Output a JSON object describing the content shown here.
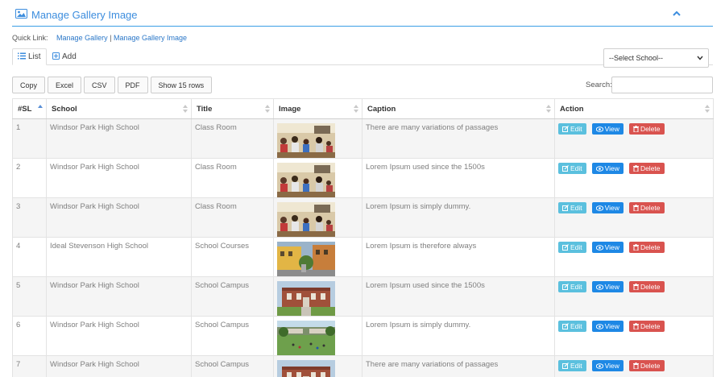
{
  "header": {
    "title": "Manage Gallery Image"
  },
  "quick_links": {
    "label": "Quick Link:",
    "items": [
      "Manage Gallery",
      "Manage Gallery Image"
    ],
    "separator": "|"
  },
  "tabs": [
    {
      "label": "List",
      "active": true
    },
    {
      "label": "Add",
      "active": false
    }
  ],
  "school_select": {
    "selected": "--Select School--"
  },
  "export_buttons": [
    "Copy",
    "Excel",
    "CSV",
    "PDF",
    "Show 15 rows"
  ],
  "search": {
    "label": "Search:",
    "value": "",
    "placeholder": ""
  },
  "table": {
    "columns": [
      "#SL",
      "School",
      "Title",
      "Image",
      "Caption",
      "Action"
    ],
    "sorted_column": "#SL",
    "rows": [
      {
        "sl": "1",
        "school": "Windsor Park High School",
        "title": "Class Room",
        "caption": "There are many variations of passages",
        "image": "classroom"
      },
      {
        "sl": "2",
        "school": "Windsor Park High School",
        "title": "Class Room",
        "caption": "Lorem Ipsum used since the 1500s",
        "image": "classroom"
      },
      {
        "sl": "3",
        "school": "Windsor Park High School",
        "title": "Class Room",
        "caption": "Lorem Ipsum is simply dummy.",
        "image": "classroom"
      },
      {
        "sl": "4",
        "school": "Ideal Stevenson High School",
        "title": "School Courses",
        "caption": "Lorem Ipsum is therefore always",
        "image": "courtyard"
      },
      {
        "sl": "5",
        "school": "Windsor Park High School",
        "title": "School Campus",
        "caption": "Lorem Ipsum used since the 1500s",
        "image": "campus-building"
      },
      {
        "sl": "6",
        "school": "Windsor Park High School",
        "title": "School Campus",
        "caption": "Lorem Ipsum is simply dummy.",
        "image": "campus-lawn"
      },
      {
        "sl": "7",
        "school": "Windsor Park High School",
        "title": "School Campus",
        "caption": "There are many variations of passages",
        "image": "campus-building"
      }
    ],
    "actions": {
      "edit": "Edit",
      "view": "View",
      "delete": "Delete"
    }
  },
  "colors": {
    "accent": "#3c8dde",
    "edit": "#5bc0de",
    "view": "#1e88e5",
    "delete": "#d9534f",
    "row_stripe": "#f5f5f5"
  },
  "icons": {
    "header": "image-icon",
    "collapse": "chevron-up-icon",
    "list_tab": "list-icon",
    "add_tab": "plus-square-icon",
    "edit": "edit-icon",
    "view": "eye-icon",
    "delete": "trash-icon"
  }
}
